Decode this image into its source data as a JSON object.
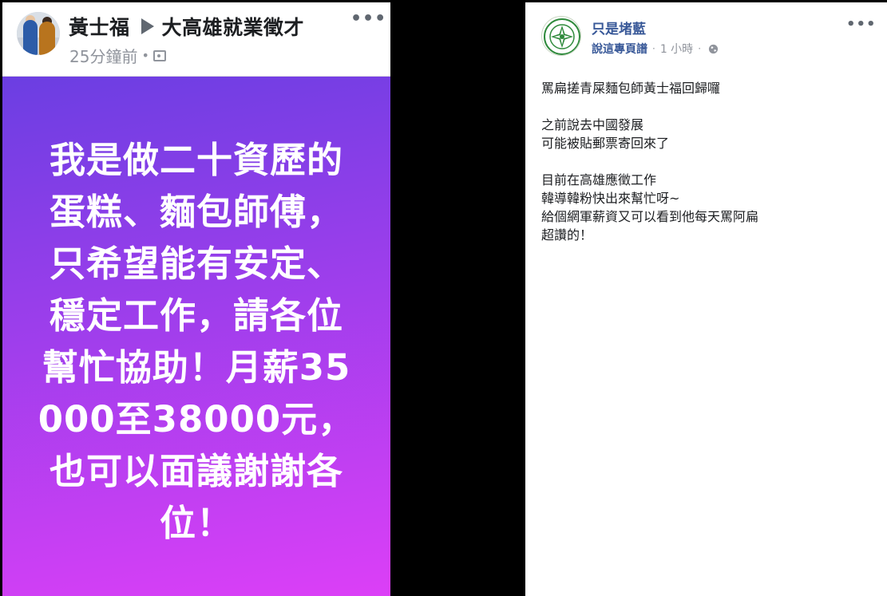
{
  "left_post": {
    "author": "黃士福",
    "group": "大高雄就業徵才",
    "time": "25分鐘前",
    "separator": "•",
    "privacy_icon": "photo-icon",
    "more_label": "•••",
    "card_text": "我是做二十資歷的蛋糕、麵包師傅，只希望能有安定、穩定工作，請各位幫忙協助！月薪35000至38000元，也可以面議謝謝各位！",
    "card_colors": [
      "#6b3ee2",
      "#dc3ff7"
    ]
  },
  "right_post": {
    "page_name": "只是堵藍",
    "posted_by": "說這專頁譜",
    "separator": "·",
    "time": "1 小時",
    "audience_icon": "globe-icon",
    "more_label": "•••",
    "paragraphs": [
      "罵扁搓青屎麵包師黃士福回歸囉",
      "之前說去中國發展\n可能被貼郵票寄回來了",
      "目前在高雄應徵工作\n韓導韓粉快出來幫忙呀~\n給個網軍薪資又可以看到他每天罵阿扁\n超讚的！"
    ],
    "name_color": "#385898"
  }
}
